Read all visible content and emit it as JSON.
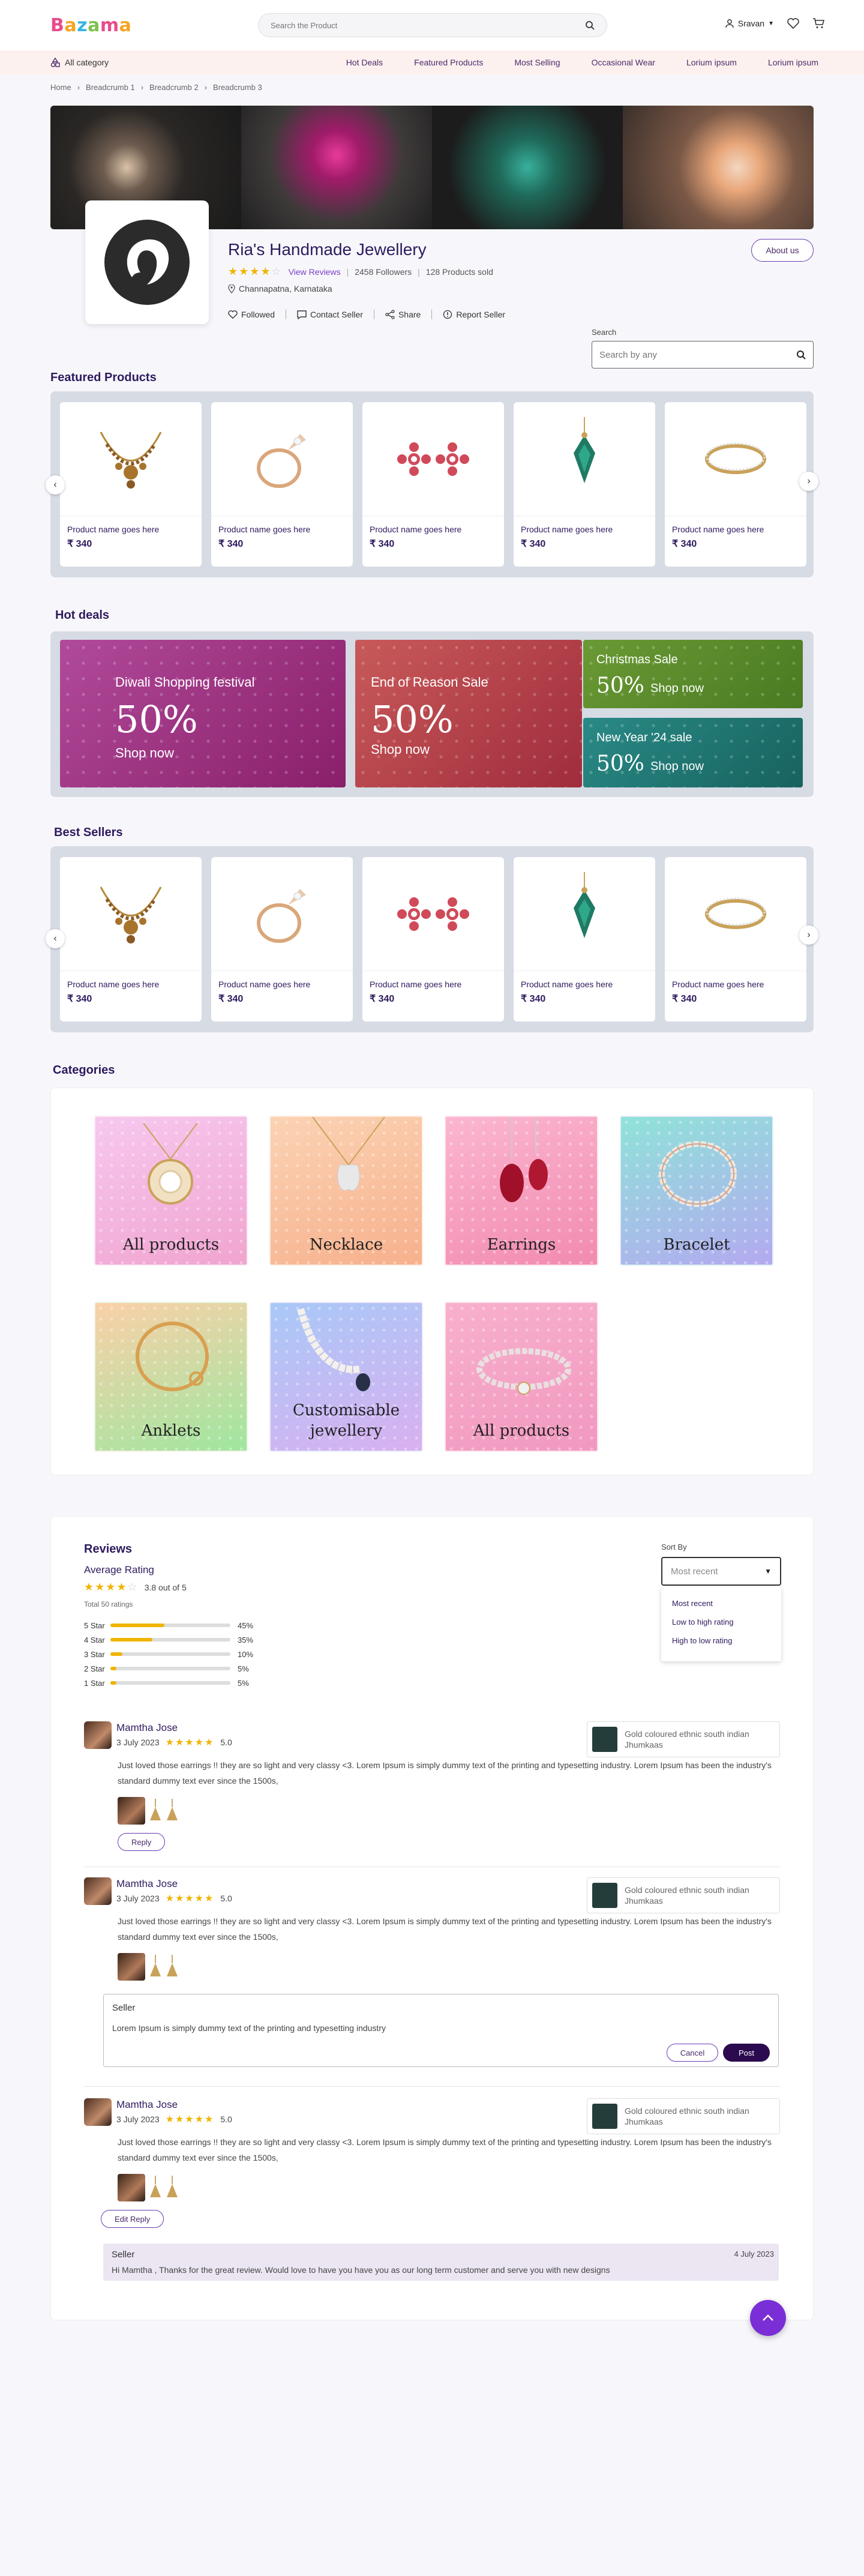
{
  "header": {
    "logo_letters": [
      "B",
      "a",
      "z",
      "a",
      "m",
      "a"
    ],
    "search_placeholder": "Search the Product",
    "user_name": "Sravan"
  },
  "catbar": {
    "all_category": "All category",
    "nav": [
      "Hot Deals",
      "Featured Products",
      "Most Selling",
      "Occasional Wear",
      "Lorium ipsum",
      "Lorium ipsum"
    ]
  },
  "breadcrumbs": [
    "Home",
    "Breadcrumb 1",
    "Breadcrumb 2",
    "Breadcrumb 3"
  ],
  "shop": {
    "name": "Ria's Handmade Jewellery",
    "rating_stars": 4,
    "view_reviews": "View Reviews",
    "followers": "2458 Followers",
    "sold": "128 Products sold",
    "location": "Channapatna, Karnataka",
    "actions": [
      "Followed",
      "Contact Seller",
      "Share",
      "Report Seller"
    ],
    "about_label": "About us"
  },
  "shop_search": {
    "label": "Search",
    "placeholder": "Search by any"
  },
  "featured": {
    "title": "Featured Products",
    "products": [
      {
        "name": "Product name goes here",
        "price": "₹ 340",
        "icon": "necklace-icon"
      },
      {
        "name": "Product name goes here",
        "price": "₹ 340",
        "icon": "ring-icon"
      },
      {
        "name": "Product name goes here",
        "price": "₹ 340",
        "icon": "earrings-icon"
      },
      {
        "name": "Product name goes here",
        "price": "₹ 340",
        "icon": "pendant-icon"
      },
      {
        "name": "Product name goes here",
        "price": "₹ 340",
        "icon": "band-ring-icon"
      }
    ]
  },
  "hot_deals": {
    "title": "Hot deals",
    "deals": [
      {
        "title": "Diwali Shopping festival",
        "percent": "50%",
        "cta": "Shop now",
        "color": "#a4327e"
      },
      {
        "title": "End of Reason Sale",
        "percent": "50%",
        "cta": "Shop now",
        "color": "#b8404a"
      },
      {
        "title": "Christmas Sale",
        "percent": "50%",
        "cta": "Shop now",
        "color": "#5f8a2c"
      },
      {
        "title": "New Year '24 sale",
        "percent": "50%",
        "cta": "Shop now",
        "color": "#1e7a74"
      }
    ]
  },
  "best_sellers": {
    "title": "Best Sellers",
    "products": [
      {
        "name": "Product name goes here",
        "price": "₹ 340",
        "icon": "necklace-icon"
      },
      {
        "name": "Product name goes here",
        "price": "₹ 340",
        "icon": "ring-icon"
      },
      {
        "name": "Product name goes here",
        "price": "₹ 340",
        "icon": "earrings-icon"
      },
      {
        "name": "Product name goes here",
        "price": "₹ 340",
        "icon": "pendant-icon"
      },
      {
        "name": "Product name goes here",
        "price": "₹ 340",
        "icon": "band-ring-icon"
      }
    ]
  },
  "categories": {
    "title": "Categories",
    "items": [
      {
        "label": "All products"
      },
      {
        "label": "Necklace"
      },
      {
        "label": "Earrings"
      },
      {
        "label": "Bracelet"
      },
      {
        "label": "Anklets"
      },
      {
        "label": "Customisable jewellery"
      },
      {
        "label": "All products"
      }
    ]
  },
  "reviews": {
    "title": "Reviews",
    "avg_title": "Average Rating",
    "avg_text": "3.8 out of 5",
    "total": "Total 50 ratings",
    "breakdown": [
      {
        "label": "5 Star",
        "pct": "45%",
        "fraction": 0.45
      },
      {
        "label": "4 Star",
        "pct": "35%",
        "fraction": 0.35
      },
      {
        "label": "3 Star",
        "pct": "10%",
        "fraction": 0.1
      },
      {
        "label": "2 Star",
        "pct": "5%",
        "fraction": 0.05
      },
      {
        "label": "1 Star",
        "pct": "5%",
        "fraction": 0.05
      }
    ],
    "sort_label": "Sort By",
    "sort_selected": "Most recent",
    "sort_options": [
      "Most recent",
      "Low to high rating",
      "High to low rating"
    ],
    "items": [
      {
        "name": "Mamtha Jose",
        "date": "3 July 2023",
        "score": "5.0",
        "text": "Just loved those earrings !! they are so light and very classy <3. Lorem Ipsum is simply dummy text of the printing and typesetting industry. Lorem Ipsum has been the industry's standard dummy text ever since the 1500s,",
        "product": "Gold coloured ethnic south indian Jhumkaas",
        "button": "Reply"
      },
      {
        "name": "Mamtha Jose",
        "date": "3 July 2023",
        "score": "5.0",
        "text": "Just loved those earrings !! they are so light and very classy <3. Lorem Ipsum is simply dummy text of the printing and typesetting industry. Lorem Ipsum has been the industry's standard dummy text ever since the 1500s,",
        "product": "Gold coloured ethnic south indian Jhumkaas"
      },
      {
        "name": "Mamtha Jose",
        "date": "3 July 2023",
        "score": "5.0",
        "text": "Just loved those earrings !! they are so light and very classy <3. Lorem Ipsum is simply dummy text of the printing and typesetting industry. Lorem Ipsum has been the industry's standard dummy text ever since the 1500s,",
        "product": "Gold coloured ethnic south indian Jhumkaas",
        "button": "Edit Reply"
      }
    ],
    "reply_form": {
      "who": "Seller",
      "text": "Lorem Ipsum is simply dummy text of the printing and typesetting industry",
      "cancel": "Cancel",
      "post": "Post"
    },
    "seller_reply": {
      "who": "Seller",
      "date": "4 July 2023",
      "text": "Hi Mamtha , Thanks for the great review. Would love to have you have you as our long term customer and serve you with new designs"
    }
  },
  "colors": {
    "brand_purple": "#2e1a5e",
    "accent": "#7a2fd6",
    "star": "#f0b400"
  }
}
